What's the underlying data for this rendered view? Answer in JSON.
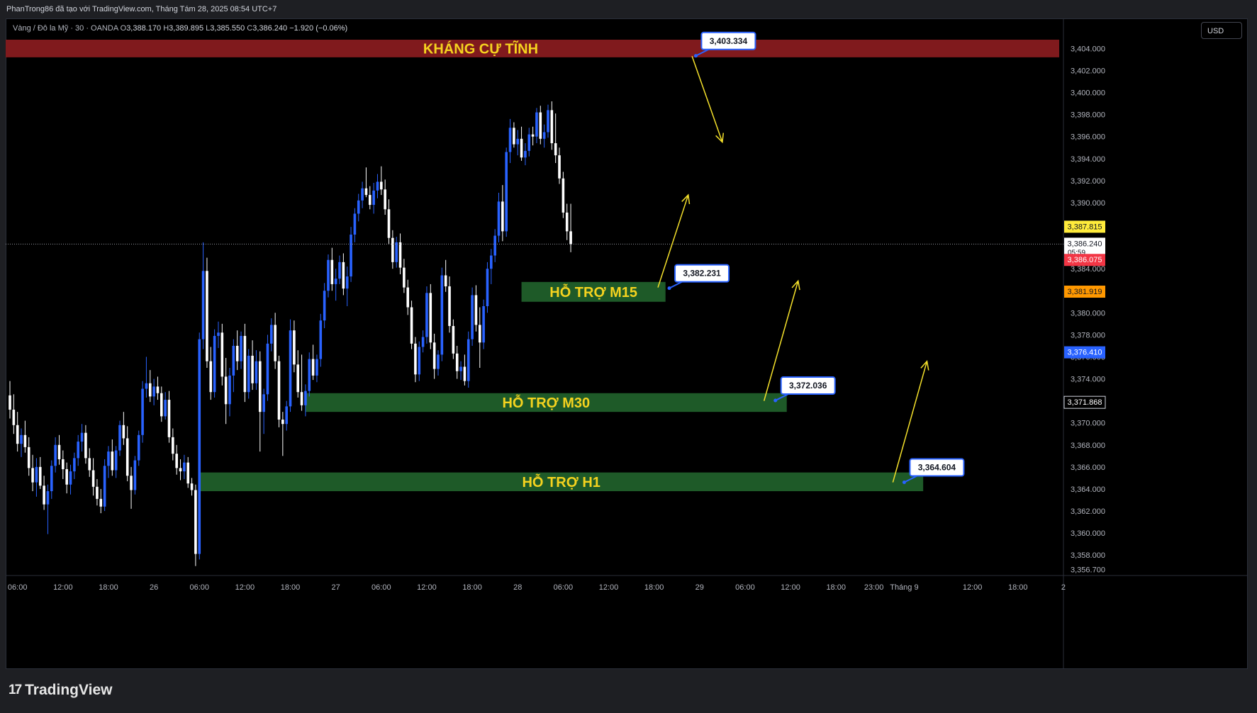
{
  "header": {
    "attribution": "PhanTrong86 đã tạo với TradingView.com, Tháng Tám 28, 2025 08:54 UTC+7"
  },
  "symbol_bar": {
    "symbol": "Vàng / Đô la Mỹ · 30 · OANDA",
    "o_label": "O",
    "open": "3,388.170",
    "h_label": "H",
    "high": "3,389.895",
    "l_label": "L",
    "low": "3,385.550",
    "c_label": "C",
    "close": "3,386.240",
    "change": "−1.920 (−0.06%)"
  },
  "currency": "USD",
  "brand": {
    "logo": "17",
    "name": "TradingView"
  },
  "colors": {
    "up": "#2962ff",
    "down": "#ffffff",
    "resistance": "#801a1d",
    "support": "#1e5a28",
    "zone_text": "#f5d31f",
    "arrow": "#f5e12b",
    "last_price_bg": "#ffffff",
    "high_label_bg": "#ffeb3b",
    "red_label": "#f23645",
    "orange_label": "#ff9800",
    "blue_label": "#2962ff"
  },
  "chart_data": {
    "type": "candlestick",
    "instrument": "XAUUSD 30m",
    "y_range": [
      3356.4,
      3404.8
    ],
    "y_ticks": [
      "3,404.000",
      "3,402.000",
      "3,400.000",
      "3,398.000",
      "3,396.000",
      "3,394.000",
      "3,392.000",
      "3,390.000",
      "3,388.000",
      "3,386.000",
      "3,384.000",
      "3,382.000",
      "3,380.000",
      "3,378.000",
      "3,376.000",
      "3,374.000",
      "3,372.000",
      "3,370.000",
      "3,368.000",
      "3,366.000",
      "3,364.000",
      "3,362.000",
      "3,360.000",
      "3,358.000",
      "3,356.700"
    ],
    "x_ticks": [
      {
        "i": 2,
        "label": "06:00"
      },
      {
        "i": 14,
        "label": "12:00"
      },
      {
        "i": 26,
        "label": "18:00"
      },
      {
        "i": 38,
        "label": "26"
      },
      {
        "i": 50,
        "label": "06:00"
      },
      {
        "i": 62,
        "label": "12:00"
      },
      {
        "i": 74,
        "label": "18:00"
      },
      {
        "i": 86,
        "label": "27"
      },
      {
        "i": 98,
        "label": "06:00"
      },
      {
        "i": 110,
        "label": "12:00"
      },
      {
        "i": 122,
        "label": "18:00"
      },
      {
        "i": 134,
        "label": "28"
      },
      {
        "i": 146,
        "label": "06:00"
      },
      {
        "i": 158,
        "label": "12:00"
      },
      {
        "i": 170,
        "label": "18:00"
      },
      {
        "i": 182,
        "label": "29"
      },
      {
        "i": 194,
        "label": "06:00"
      },
      {
        "i": 206,
        "label": "12:00"
      },
      {
        "i": 218,
        "label": "18:00"
      },
      {
        "i": 228,
        "label": "23:00"
      },
      {
        "i": 236,
        "label": "Tháng 9"
      },
      {
        "i": 254,
        "label": "12:00"
      },
      {
        "i": 266,
        "label": "18:00"
      },
      {
        "i": 278,
        "label": "2"
      }
    ],
    "candles": [
      [
        3372.5,
        3373.8,
        3370.4,
        3371.2
      ],
      [
        3371.2,
        3372.6,
        3369.0,
        3369.8
      ],
      [
        3369.8,
        3371.0,
        3367.4,
        3368.1
      ],
      [
        3368.1,
        3369.5,
        3366.9,
        3368.9
      ],
      [
        3368.9,
        3370.2,
        3367.3,
        3367.8
      ],
      [
        3367.8,
        3368.7,
        3365.2,
        3365.9
      ],
      [
        3365.9,
        3367.1,
        3363.8,
        3364.6
      ],
      [
        3364.6,
        3366.8,
        3363.3,
        3366.0
      ],
      [
        3366.0,
        3366.9,
        3364.0,
        3364.3
      ],
      [
        3364.3,
        3365.2,
        3362.1,
        3362.6
      ],
      [
        3362.6,
        3364.4,
        3359.9,
        3363.8
      ],
      [
        3363.8,
        3366.6,
        3363.1,
        3366.1
      ],
      [
        3366.1,
        3368.7,
        3365.5,
        3368.0
      ],
      [
        3368.0,
        3368.9,
        3366.2,
        3366.7
      ],
      [
        3366.7,
        3367.5,
        3364.9,
        3365.8
      ],
      [
        3365.8,
        3366.4,
        3363.6,
        3364.4
      ],
      [
        3364.4,
        3366.2,
        3363.5,
        3365.6
      ],
      [
        3365.6,
        3367.3,
        3364.9,
        3366.8
      ],
      [
        3366.8,
        3368.9,
        3366.1,
        3368.3
      ],
      [
        3368.3,
        3369.9,
        3367.4,
        3369.1
      ],
      [
        3369.1,
        3369.8,
        3366.3,
        3366.8
      ],
      [
        3366.8,
        3367.7,
        3365.1,
        3365.7
      ],
      [
        3365.7,
        3366.8,
        3363.4,
        3364.2
      ],
      [
        3364.2,
        3364.9,
        3362.5,
        3363.1
      ],
      [
        3363.1,
        3364.0,
        3361.8,
        3362.4
      ],
      [
        3362.4,
        3366.7,
        3362.0,
        3366.1
      ],
      [
        3366.1,
        3367.9,
        3365.0,
        3367.4
      ],
      [
        3367.4,
        3368.5,
        3365.2,
        3365.7
      ],
      [
        3365.7,
        3367.9,
        3365.0,
        3367.5
      ],
      [
        3367.5,
        3370.2,
        3367.0,
        3369.8
      ],
      [
        3369.8,
        3371.0,
        3368.0,
        3368.6
      ],
      [
        3368.6,
        3369.7,
        3364.7,
        3365.2
      ],
      [
        3365.2,
        3366.0,
        3362.2,
        3363.9
      ],
      [
        3363.9,
        3367.0,
        3363.5,
        3366.6
      ],
      [
        3366.6,
        3369.3,
        3366.1,
        3368.9
      ],
      [
        3368.9,
        3373.8,
        3368.2,
        3373.1
      ],
      [
        3373.1,
        3376.0,
        3372.3,
        3373.6
      ],
      [
        3373.6,
        3374.8,
        3371.9,
        3372.4
      ],
      [
        3372.4,
        3374.0,
        3371.6,
        3373.3
      ],
      [
        3373.3,
        3374.2,
        3372.1,
        3372.7
      ],
      [
        3372.7,
        3373.3,
        3370.1,
        3370.6
      ],
      [
        3370.6,
        3372.8,
        3370.3,
        3372.1
      ],
      [
        3372.1,
        3372.9,
        3368.2,
        3368.7
      ],
      [
        3368.7,
        3369.5,
        3366.6,
        3367.2
      ],
      [
        3367.2,
        3368.0,
        3365.3,
        3365.9
      ],
      [
        3365.9,
        3366.7,
        3364.8,
        3365.6
      ],
      [
        3365.6,
        3367.1,
        3364.9,
        3366.4
      ],
      [
        3366.4,
        3366.9,
        3364.1,
        3364.5
      ],
      [
        3364.5,
        3365.0,
        3363.4,
        3363.9
      ],
      [
        3363.9,
        3364.4,
        3357.0,
        3358.1
      ],
      [
        3358.1,
        3378.2,
        3357.6,
        3377.6
      ],
      [
        3377.6,
        3386.4,
        3376.7,
        3383.8
      ],
      [
        3383.8,
        3385.0,
        3375.0,
        3375.6
      ],
      [
        3375.6,
        3376.9,
        3372.1,
        3372.8
      ],
      [
        3372.8,
        3378.5,
        3372.3,
        3377.9
      ],
      [
        3377.9,
        3379.2,
        3376.8,
        3378.2
      ],
      [
        3378.2,
        3379.0,
        3373.4,
        3374.2
      ],
      [
        3374.2,
        3375.9,
        3369.9,
        3371.7
      ],
      [
        3371.7,
        3375.0,
        3370.6,
        3374.3
      ],
      [
        3374.3,
        3377.6,
        3372.8,
        3377.0
      ],
      [
        3377.0,
        3378.4,
        3374.8,
        3375.6
      ],
      [
        3375.6,
        3378.3,
        3374.9,
        3377.9
      ],
      [
        3377.9,
        3379.0,
        3371.9,
        3372.8
      ],
      [
        3372.8,
        3376.7,
        3372.2,
        3376.1
      ],
      [
        3376.1,
        3377.5,
        3373.0,
        3373.6
      ],
      [
        3373.6,
        3376.6,
        3373.0,
        3375.6
      ],
      [
        3375.6,
        3376.5,
        3367.4,
        3371.0
      ],
      [
        3371.0,
        3373.1,
        3369.0,
        3372.6
      ],
      [
        3372.6,
        3378.0,
        3372.0,
        3377.2
      ],
      [
        3377.2,
        3379.5,
        3376.5,
        3378.9
      ],
      [
        3378.9,
        3380.0,
        3374.9,
        3375.6
      ],
      [
        3375.6,
        3376.1,
        3369.6,
        3370.3
      ],
      [
        3370.3,
        3371.0,
        3367.0,
        3369.9
      ],
      [
        3369.9,
        3372.0,
        3369.3,
        3371.5
      ],
      [
        3371.5,
        3379.4,
        3371.0,
        3378.4
      ],
      [
        3378.4,
        3379.3,
        3374.6,
        3375.3
      ],
      [
        3375.3,
        3376.6,
        3372.3,
        3372.8
      ],
      [
        3372.8,
        3376.2,
        3371.1,
        3371.6
      ],
      [
        3371.6,
        3373.5,
        3370.6,
        3372.9
      ],
      [
        3372.9,
        3376.4,
        3372.4,
        3375.8
      ],
      [
        3375.8,
        3377.1,
        3373.9,
        3374.3
      ],
      [
        3374.3,
        3376.2,
        3373.7,
        3375.8
      ],
      [
        3375.8,
        3379.9,
        3375.1,
        3379.3
      ],
      [
        3379.3,
        3382.7,
        3378.6,
        3382.0
      ],
      [
        3382.0,
        3385.3,
        3381.4,
        3384.8
      ],
      [
        3384.8,
        3385.9,
        3382.0,
        3382.6
      ],
      [
        3382.6,
        3384.0,
        3381.1,
        3383.1
      ],
      [
        3383.1,
        3385.2,
        3382.6,
        3384.6
      ],
      [
        3384.6,
        3385.4,
        3381.6,
        3382.2
      ],
      [
        3382.2,
        3384.2,
        3380.6,
        3383.3
      ],
      [
        3383.3,
        3387.8,
        3382.8,
        3387.1
      ],
      [
        3387.1,
        3389.5,
        3386.4,
        3389.0
      ],
      [
        3389.0,
        3390.8,
        3388.3,
        3390.2
      ],
      [
        3390.2,
        3391.9,
        3389.5,
        3391.3
      ],
      [
        3391.3,
        3393.2,
        3390.5,
        3390.7
      ],
      [
        3390.7,
        3391.5,
        3389.4,
        3389.8
      ],
      [
        3389.8,
        3391.8,
        3389.0,
        3391.1
      ],
      [
        3391.1,
        3392.6,
        3390.4,
        3391.9
      ],
      [
        3391.9,
        3393.3,
        3390.7,
        3391.2
      ],
      [
        3391.2,
        3392.1,
        3388.9,
        3389.4
      ],
      [
        3389.4,
        3390.3,
        3386.2,
        3386.8
      ],
      [
        3386.8,
        3387.5,
        3384.0,
        3384.6
      ],
      [
        3384.6,
        3386.9,
        3384.1,
        3386.4
      ],
      [
        3386.4,
        3387.2,
        3383.5,
        3384.1
      ],
      [
        3384.1,
        3384.9,
        3381.8,
        3382.3
      ],
      [
        3382.3,
        3383.0,
        3379.8,
        3380.5
      ],
      [
        3380.5,
        3381.1,
        3376.7,
        3377.2
      ],
      [
        3377.2,
        3377.8,
        3373.7,
        3374.4
      ],
      [
        3374.4,
        3377.4,
        3373.8,
        3376.9
      ],
      [
        3376.9,
        3378.4,
        3376.4,
        3377.8
      ],
      [
        3377.8,
        3382.4,
        3377.2,
        3381.8
      ],
      [
        3381.8,
        3382.6,
        3376.7,
        3377.3
      ],
      [
        3377.3,
        3378.1,
        3374.0,
        3374.9
      ],
      [
        3374.9,
        3376.6,
        3374.3,
        3376.2
      ],
      [
        3376.2,
        3384.1,
        3375.6,
        3383.4
      ],
      [
        3383.4,
        3384.8,
        3381.9,
        3382.4
      ],
      [
        3382.4,
        3383.3,
        3378.2,
        3378.8
      ],
      [
        3378.8,
        3379.4,
        3375.8,
        3376.3
      ],
      [
        3376.3,
        3377.0,
        3374.0,
        3374.7
      ],
      [
        3374.7,
        3375.6,
        3373.9,
        3375.1
      ],
      [
        3375.1,
        3376.2,
        3373.4,
        3373.8
      ],
      [
        3373.8,
        3378.3,
        3373.2,
        3377.6
      ],
      [
        3377.6,
        3382.3,
        3377.0,
        3381.6
      ],
      [
        3381.6,
        3382.5,
        3378.3,
        3378.9
      ],
      [
        3378.9,
        3380.5,
        3375.0,
        3377.3
      ],
      [
        3377.3,
        3381.2,
        3376.7,
        3380.6
      ],
      [
        3380.6,
        3384.6,
        3380.0,
        3384.0
      ],
      [
        3384.0,
        3385.8,
        3382.6,
        3385.2
      ],
      [
        3385.2,
        3387.6,
        3384.6,
        3387.0
      ],
      [
        3387.0,
        3390.9,
        3386.4,
        3390.1
      ],
      [
        3390.1,
        3391.6,
        3386.5,
        3387.4
      ],
      [
        3387.4,
        3395.0,
        3386.9,
        3394.6
      ],
      [
        3394.6,
        3397.6,
        3393.6,
        3396.8
      ],
      [
        3396.8,
        3397.3,
        3395.0,
        3395.3
      ],
      [
        3395.3,
        3396.6,
        3394.3,
        3395.8
      ],
      [
        3395.8,
        3396.9,
        3393.8,
        3394.1
      ],
      [
        3394.1,
        3395.4,
        3393.4,
        3394.7
      ],
      [
        3394.7,
        3396.8,
        3394.2,
        3396.2
      ],
      [
        3396.2,
        3396.9,
        3395.2,
        3396.0
      ],
      [
        3396.0,
        3398.6,
        3395.4,
        3398.2
      ],
      [
        3398.2,
        3398.8,
        3395.3,
        3395.8
      ],
      [
        3395.8,
        3397.1,
        3395.0,
        3396.4
      ],
      [
        3396.4,
        3398.9,
        3395.9,
        3398.4
      ],
      [
        3398.4,
        3399.2,
        3394.8,
        3395.4
      ],
      [
        3395.4,
        3398.1,
        3393.6,
        3394.3
      ],
      [
        3394.3,
        3395.0,
        3391.7,
        3392.2
      ],
      [
        3392.2,
        3392.8,
        3388.6,
        3389.1
      ],
      [
        3389.1,
        3389.9,
        3386.6,
        3387.4
      ],
      [
        3387.4,
        3389.9,
        3385.5,
        3386.24
      ]
    ],
    "zones": [
      {
        "label": "KHÁNG CỰ TĨNH",
        "top": 3404.8,
        "bottom": 3403.2,
        "i_from": -2,
        "i_to": 300,
        "kind": "resistance"
      },
      {
        "label": "HỖ TRỢ M15",
        "top": 3382.8,
        "bottom": 3381.0,
        "i_from": 135,
        "i_to": 173,
        "kind": "support"
      },
      {
        "label": "HỖ TRỢ M30",
        "top": 3372.7,
        "bottom": 3371.0,
        "i_from": 78,
        "i_to": 205,
        "kind": "support"
      },
      {
        "label": "HỖ TRỢ H1",
        "top": 3365.5,
        "bottom": 3363.8,
        "i_from": 50,
        "i_to": 241,
        "kind": "support"
      }
    ],
    "callouts": [
      {
        "text": "3,403.334",
        "i": 181,
        "price": 3403.334
      },
      {
        "text": "3,382.231",
        "i": 174,
        "price": 3382.231
      },
      {
        "text": "3,372.036",
        "i": 202,
        "price": 3372.036
      },
      {
        "text": "3,364.604",
        "i": 236,
        "price": 3364.604
      }
    ],
    "arrows": [
      {
        "from": [
          180,
          3403.3
        ],
        "to": [
          188,
          3395.5
        ]
      },
      {
        "from": [
          171,
          3382.3
        ],
        "to": [
          179,
          3390.7
        ]
      },
      {
        "from": [
          199,
          3372.0
        ],
        "to": [
          208,
          3382.9
        ]
      },
      {
        "from": [
          233,
          3364.6
        ],
        "to": [
          242,
          3375.6
        ]
      }
    ],
    "price_labels": [
      {
        "text": "3,387.815",
        "price": 3387.815,
        "kind": "high"
      },
      {
        "text": "3,386.240",
        "sub": "05:59",
        "price": 3386.24,
        "kind": "last"
      },
      {
        "text": "3,386.075",
        "price": 3384.8,
        "kind": "red"
      },
      {
        "text": "3,381.919",
        "price": 3381.919,
        "kind": "orange"
      },
      {
        "text": "3,376.410",
        "price": 3376.41,
        "kind": "blue"
      },
      {
        "text": "3,371.868",
        "price": 3371.868,
        "kind": "plain"
      }
    ],
    "last_price": 3386.24
  }
}
